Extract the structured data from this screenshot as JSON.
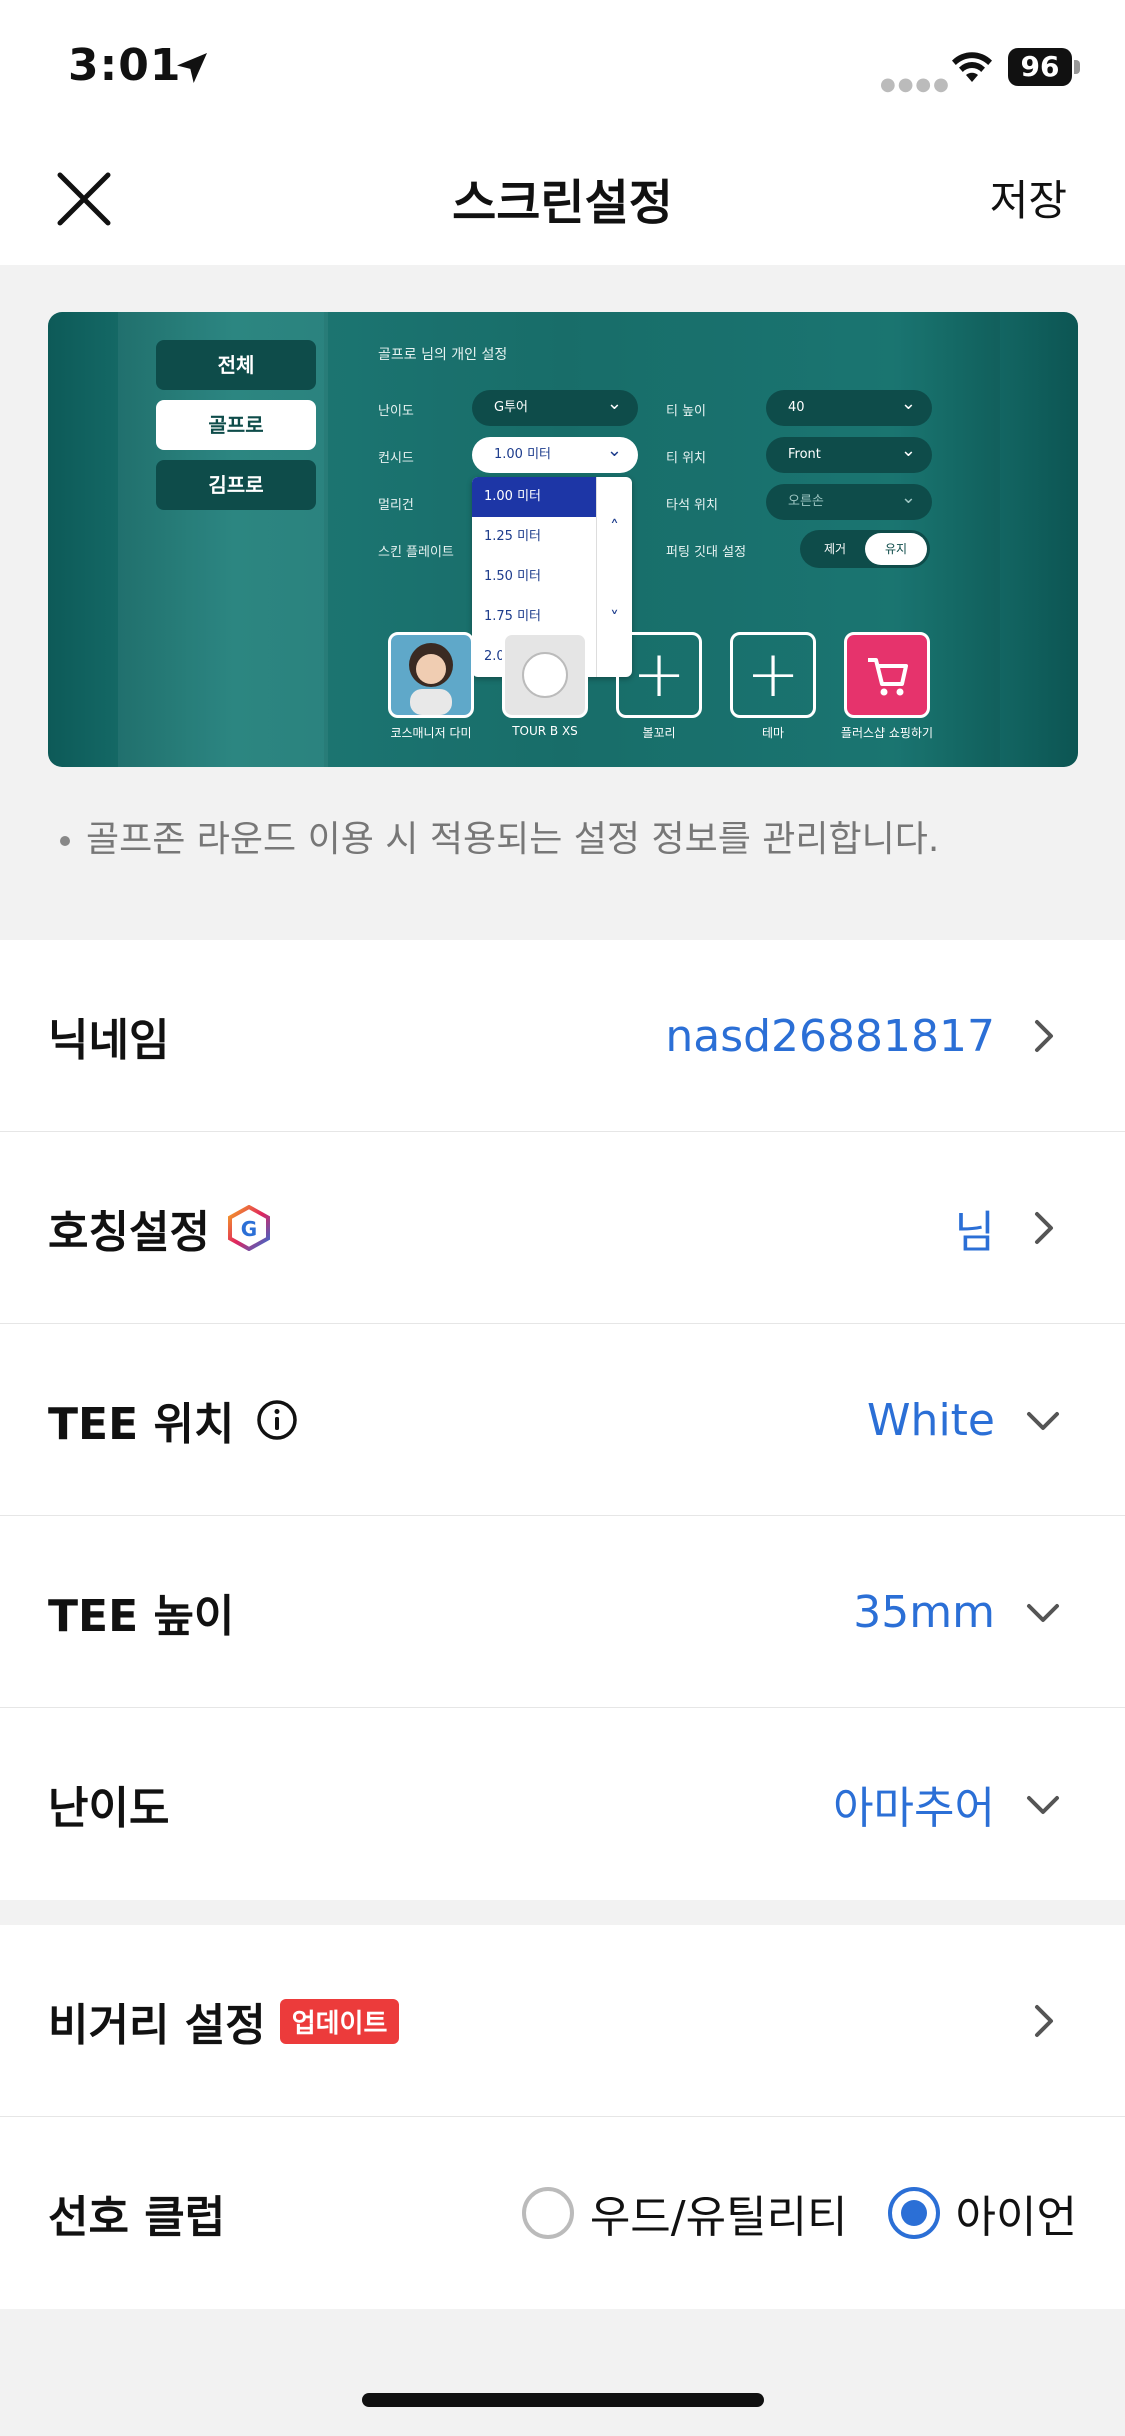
{
  "status_bar": {
    "time": "3:01",
    "battery": "96"
  },
  "header": {
    "title": "스크린설정",
    "save_label": "저장"
  },
  "banner": {
    "tabs": [
      "전체",
      "골프로",
      "김프로"
    ],
    "panel_title": "골프로 님의 개인 설정",
    "labels": {
      "difficulty": "난이도",
      "concede": "컨시드",
      "mulligan": "멀리건",
      "skin_play": "스킨 플레이트",
      "tee_height": "티 높이",
      "tee_pos": "티 위치",
      "hit_pos": "타석 위치",
      "putting": "퍼팅 깃대 설정"
    },
    "values": {
      "difficulty": "G투어",
      "concede": "1.00 미터",
      "tee_height": "40",
      "tee_pos": "Front",
      "hit_pos": "오른손"
    },
    "concede_options": [
      "1.00 미터",
      "1.25 미터",
      "1.50 미터",
      "1.75 미터",
      "2.00 미터"
    ],
    "toggle": {
      "off": "제거",
      "on": "유지"
    },
    "tiles": [
      "코스매니저 다미",
      "TOUR B XS",
      "볼꼬리",
      "테마",
      "플러스샵 쇼핑하기"
    ]
  },
  "note": "골프존 라운드 이용 시 적용되는 설정 정보를 관리합니다.",
  "settings": {
    "nickname": {
      "label": "닉네임",
      "value": "nasd26881817"
    },
    "title": {
      "label": "호칭설정",
      "value": "님"
    },
    "tee_position": {
      "label": "TEE 위치",
      "value": "White"
    },
    "tee_height": {
      "label": "TEE 높이",
      "value": "35mm"
    },
    "difficulty": {
      "label": "난이도",
      "value": "아마추어"
    }
  },
  "extra": {
    "distance": {
      "label": "비거리 설정",
      "badge": "업데이트"
    },
    "club": {
      "label": "선호 클럽",
      "options": [
        "우드/유틸리티",
        "아이언"
      ],
      "selected": "아이언"
    }
  },
  "colors": {
    "accent": "#2b6fd6",
    "badge": "#ec3b3b",
    "banner": "#1a736f"
  }
}
